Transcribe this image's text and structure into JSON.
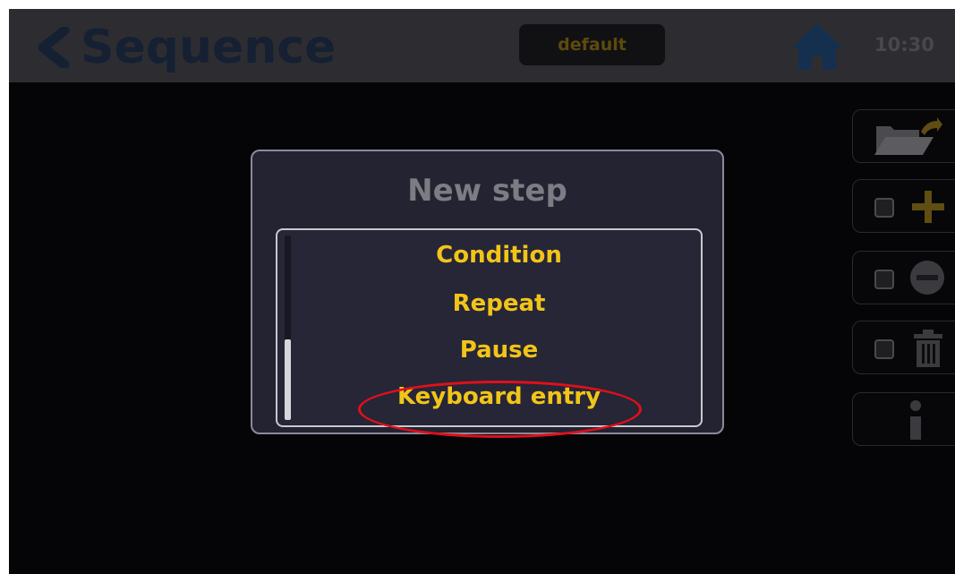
{
  "header": {
    "title": "Sequence",
    "profile": "default",
    "time": "10:30"
  },
  "dialog": {
    "title": "New step",
    "items": [
      "Condition",
      "Repeat",
      "Pause",
      "Keyboard entry"
    ],
    "highlighted_item": "Keyboard entry",
    "scroll_position": 1.0
  },
  "sidebar": {
    "buttons": [
      "open-folder-icon",
      "add-icon",
      "remove-icon",
      "trash-icon",
      "info-icon"
    ]
  },
  "colors": {
    "accent": "#f2c419",
    "highlight": "#e10f1b",
    "header_bg": "#2d2d31",
    "screen_bg": "#050507"
  }
}
